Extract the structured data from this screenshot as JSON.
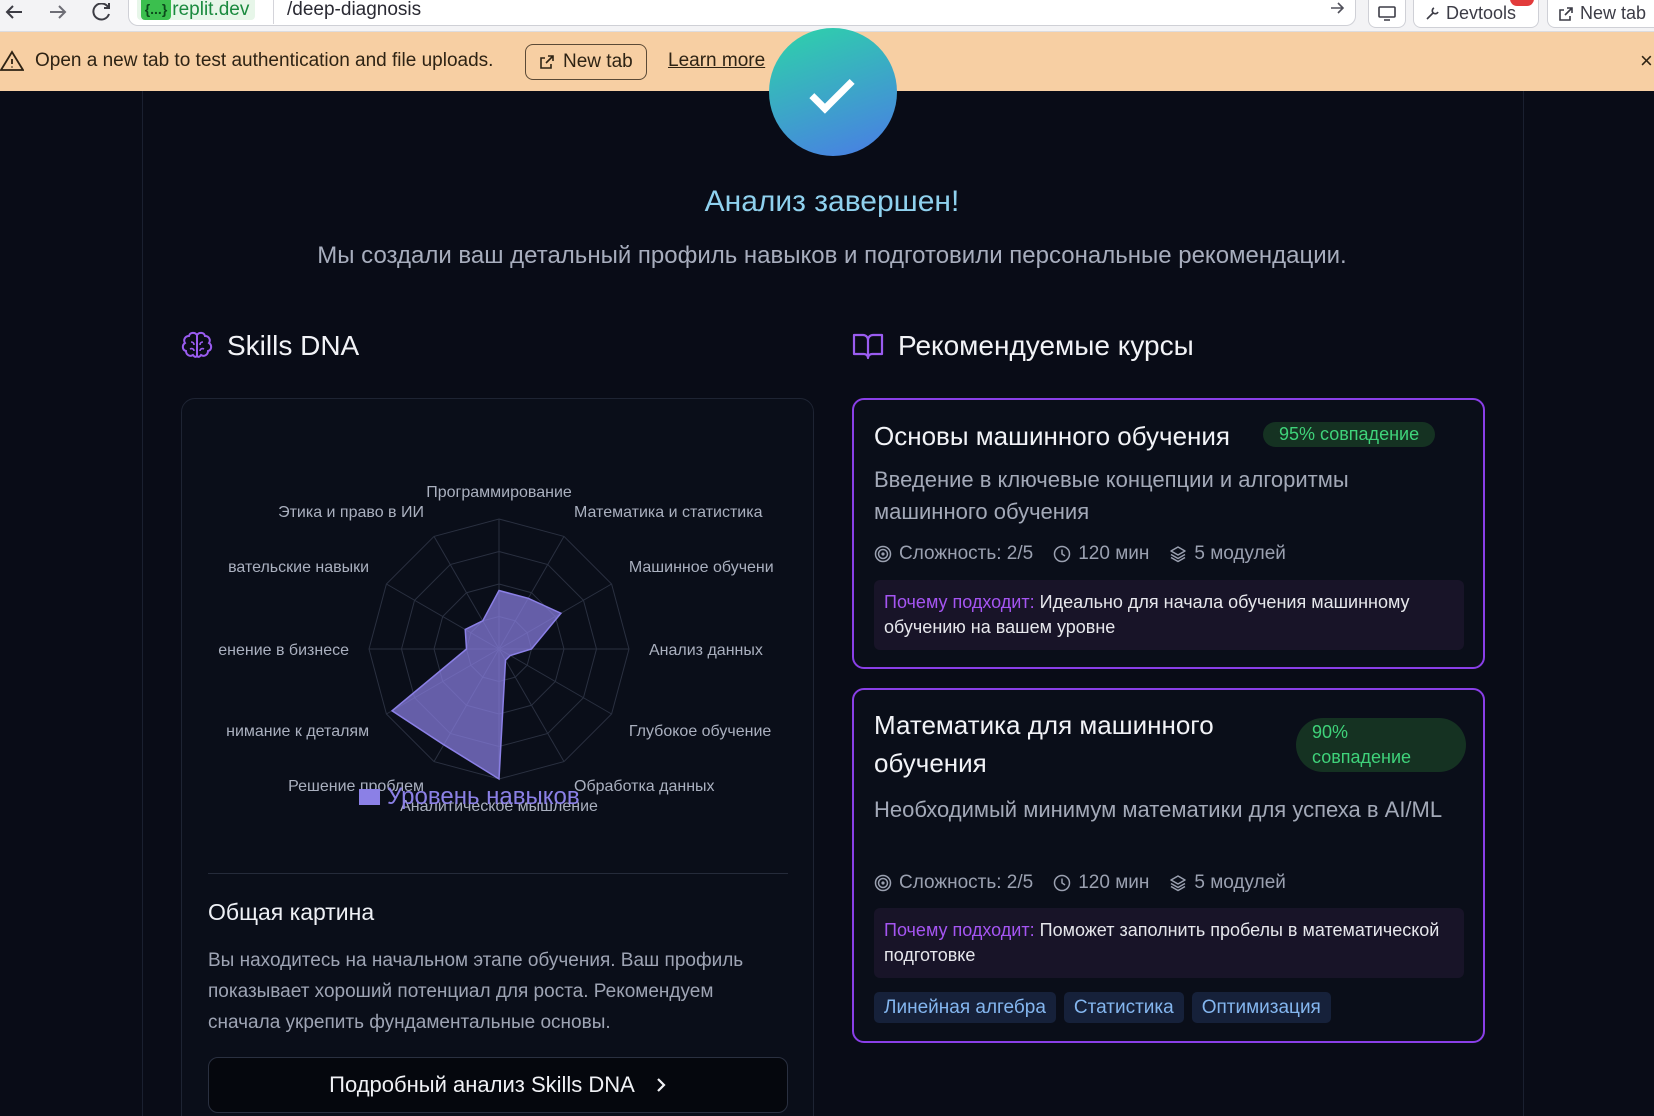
{
  "browser": {
    "domain": ".replit.dev",
    "domain_logo": "{...}",
    "path": "/deep-diagnosis",
    "devtools_label": "Devtools",
    "new_tab_label": "New tab"
  },
  "banner": {
    "message": "Open a new tab to test authentication and file uploads.",
    "new_tab_button": "New tab",
    "learn_more": "Learn more",
    "bg_color": "#f7cfa3"
  },
  "hero": {
    "title": "Анализ завершен!",
    "subtitle": "Мы создали ваш детальный профиль навыков и подготовили персональные рекомендации."
  },
  "skills": {
    "heading": "Skills DNA",
    "legend": "Уровень навыков",
    "overview_title": "Общая картина",
    "overview_text": "Вы находитесь на начальном этапе обучения. Ваш профиль показывает хороший потенциал для роста. Рекомендуем сначала укрепить фундаментальные основы.",
    "details_button": "Подробный анализ Skills DNA"
  },
  "chart_data": {
    "type": "radar",
    "categories": [
      "Программирование",
      "Математика и статистика",
      "Машинное обучени",
      "Анализ данных",
      "Глубокое обучение",
      "Обработка данных",
      "Аналитическое мышление",
      "Решение проблем",
      "нимание к деталям",
      "енение в бизнесе",
      "вательские навыки",
      "Этика и право в ИИ"
    ],
    "series": [
      {
        "name": "Уровень навыков",
        "values": [
          45,
          45,
          55,
          25,
          10,
          10,
          100,
          85,
          95,
          25,
          30,
          25
        ],
        "color": "#8b80e6"
      }
    ],
    "rmax": 100,
    "rings": 4
  },
  "courses": {
    "heading": "Рекомендуемые курсы",
    "items": [
      {
        "title": "Основы машинного обучения",
        "match": "95% совпадение",
        "description": "Введение в ключевые концепции и алгоритмы машинного обучения",
        "difficulty": "Сложность: 2/5",
        "duration": "120 мин",
        "modules": "5 модулей",
        "why_label": "Почему подходит:",
        "why_text": "Идеально для начала обучения машинному обучению на вашем уровне"
      },
      {
        "title": "Математика для машинного обучения",
        "match": "90% совпадение",
        "description": "Необходимый минимум математики для успеха в AI/ML",
        "difficulty": "Сложность: 2/5",
        "duration": "120 мин",
        "modules": "5 модулей",
        "why_label": "Почему подходит:",
        "why_text": "Поможет заполнить пробелы в математической подготовке",
        "tags": [
          "Линейная алгебра",
          "Статистика",
          "Оптимизация"
        ]
      }
    ]
  },
  "colors": {
    "accent": "#8a3fe8",
    "match_text": "#3fd27a",
    "title": "#8fd1ee"
  }
}
